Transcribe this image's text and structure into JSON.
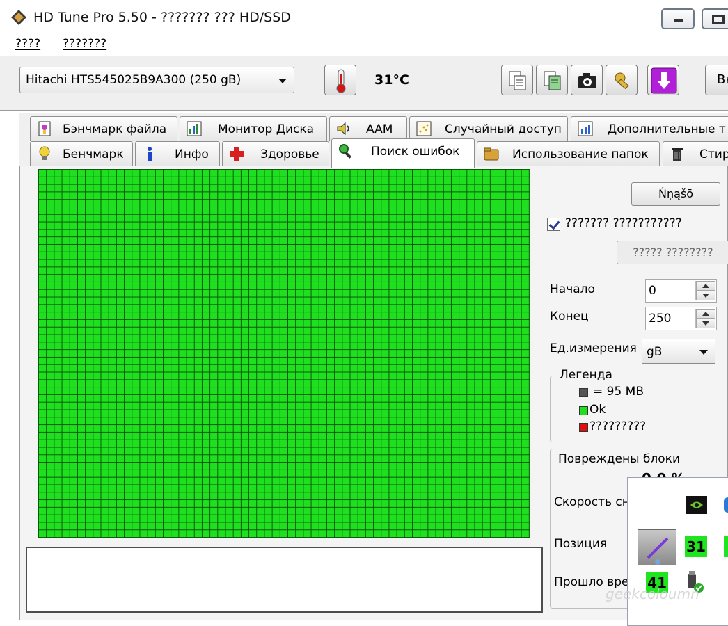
{
  "window": {
    "title": "HD Tune Pro 5.50 - ??????? ??? HD/SSD"
  },
  "menu": {
    "items": [
      "????",
      "???????"
    ]
  },
  "toolbar": {
    "drive": "Hitachi HTS545025B9A300 (250 gB)",
    "temperature": "31°C",
    "exit_label": "Вы"
  },
  "tabs": {
    "row1": [
      "Бэнчмарк файла",
      "Монитор Диска",
      "AAM",
      "Случайный доступ",
      "Дополнительные т"
    ],
    "row2": [
      "Бенчмарк",
      "Инфо",
      "Здоровье",
      "Поиск ошибок",
      "Использование папок",
      "Стир"
    ],
    "active": "Поиск ошибок"
  },
  "scan": {
    "start_button": "Ńņąšō",
    "quick_scan_label": "??????? ???????????",
    "quick_scan_checked": true,
    "scan_button": "????? ????????",
    "start_label": "Начало",
    "start_value": "0",
    "end_label": "Конец",
    "end_value": "250",
    "unit_label": "Ед.измерения",
    "unit_value": "gB"
  },
  "legend": {
    "title": "Легенда",
    "block_size": "= 95 MB",
    "ok": "Ok",
    "damaged": "?????????",
    "colors": {
      "block": "#555555",
      "ok": "#1fe01f",
      "damaged": "#e01010"
    }
  },
  "stats": {
    "damaged_title": "Повреждены блоки",
    "damaged_value": "0.0 %",
    "speed_label": "Скорость сн",
    "position_label": "Позиция",
    "elapsed_label": "Прошло вре"
  },
  "tray": {
    "badge1": "31",
    "badge2": "41",
    "watermark": "geekcoloumn"
  }
}
